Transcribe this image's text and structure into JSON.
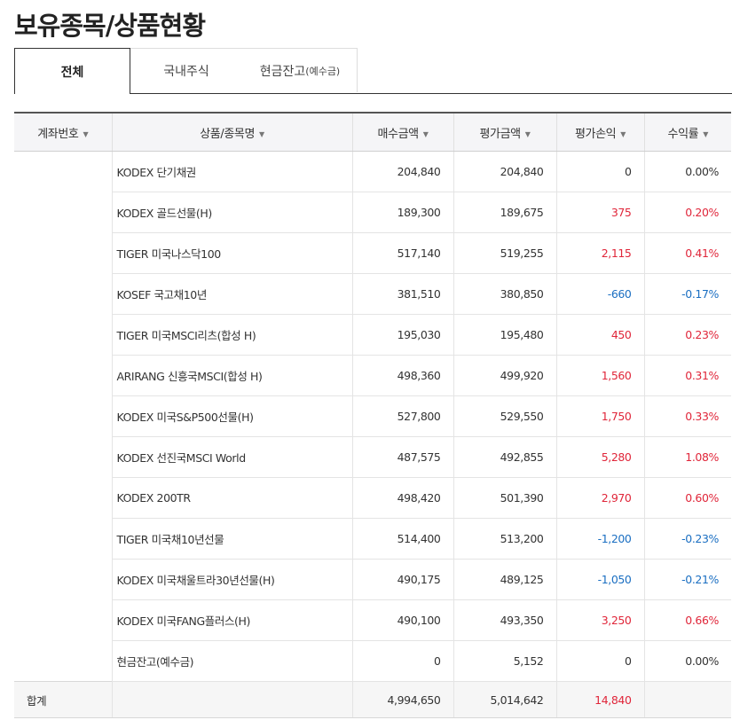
{
  "page_title": "보유종목/상품현황",
  "tabs": [
    {
      "label": "전체",
      "small": ""
    },
    {
      "label": "국내주식",
      "small": ""
    },
    {
      "label": "현금잔고",
      "small": "(예수금)"
    }
  ],
  "table": {
    "headers": [
      "계좌번호",
      "상품/종목명",
      "매수금액",
      "평가금액",
      "평가손익",
      "수익률"
    ],
    "rows": [
      {
        "name": "KODEX 단기채권",
        "buy": "204,840",
        "eval": "204,840",
        "pl": "0",
        "rate": "0.00%",
        "sign": "zero"
      },
      {
        "name": "KODEX 골드선물(H)",
        "buy": "189,300",
        "eval": "189,675",
        "pl": "375",
        "rate": "0.20%",
        "sign": "pos"
      },
      {
        "name": "TIGER 미국나스닥100",
        "buy": "517,140",
        "eval": "519,255",
        "pl": "2,115",
        "rate": "0.41%",
        "sign": "pos"
      },
      {
        "name": "KOSEF 국고채10년",
        "buy": "381,510",
        "eval": "380,850",
        "pl": "-660",
        "rate": "-0.17%",
        "sign": "neg"
      },
      {
        "name": "TIGER 미국MSCI리츠(합성 H)",
        "buy": "195,030",
        "eval": "195,480",
        "pl": "450",
        "rate": "0.23%",
        "sign": "pos"
      },
      {
        "name": "ARIRANG 신흥국MSCI(합성 H)",
        "buy": "498,360",
        "eval": "499,920",
        "pl": "1,560",
        "rate": "0.31%",
        "sign": "pos"
      },
      {
        "name": "KODEX 미국S&P500선물(H)",
        "buy": "527,800",
        "eval": "529,550",
        "pl": "1,750",
        "rate": "0.33%",
        "sign": "pos"
      },
      {
        "name": "KODEX 선진국MSCI World",
        "buy": "487,575",
        "eval": "492,855",
        "pl": "5,280",
        "rate": "1.08%",
        "sign": "pos"
      },
      {
        "name": "KODEX 200TR",
        "buy": "498,420",
        "eval": "501,390",
        "pl": "2,970",
        "rate": "0.60%",
        "sign": "pos"
      },
      {
        "name": "TIGER 미국채10년선물",
        "buy": "514,400",
        "eval": "513,200",
        "pl": "-1,200",
        "rate": "-0.23%",
        "sign": "neg"
      },
      {
        "name": "KODEX 미국채울트라30년선물(H)",
        "buy": "490,175",
        "eval": "489,125",
        "pl": "-1,050",
        "rate": "-0.21%",
        "sign": "neg"
      },
      {
        "name": "KODEX 미국FANG플러스(H)",
        "buy": "490,100",
        "eval": "493,350",
        "pl": "3,250",
        "rate": "0.66%",
        "sign": "pos"
      },
      {
        "name": "현금잔고(예수금)",
        "buy": "0",
        "eval": "5,152",
        "pl": "0",
        "rate": "0.00%",
        "sign": "zero"
      }
    ],
    "total": {
      "label": "합계",
      "buy": "4,994,650",
      "eval": "5,014,642",
      "pl": "14,840",
      "rate": ""
    }
  },
  "colors": {
    "positive": "#e0263a",
    "negative": "#1b6fc2",
    "neutral": "#333333"
  },
  "icons": {
    "sort": "sort-down-triangle-icon"
  }
}
